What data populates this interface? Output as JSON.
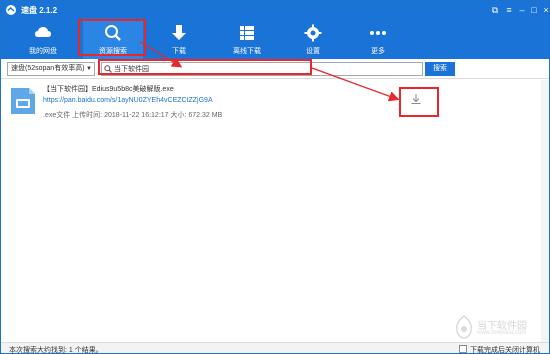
{
  "window": {
    "title": "速盘 2.1.2",
    "controls": [
      "restore-icon",
      "settings-icon",
      "minimize-icon",
      "maximize-icon",
      "close-icon"
    ]
  },
  "toolbar": {
    "items": [
      {
        "label": "我的网盘",
        "icon": "cloud-icon"
      },
      {
        "label": "资源搜索",
        "icon": "search-icon",
        "active": true
      },
      {
        "label": "下载",
        "icon": "download-icon"
      },
      {
        "label": "离线下载",
        "icon": "grid-list-icon"
      },
      {
        "label": "设置",
        "icon": "gear-icon"
      },
      {
        "label": "更多",
        "icon": "more-icon"
      }
    ]
  },
  "search": {
    "source": "速盘(52sopan有效率高)",
    "query": "当下软件园",
    "button": "搜索"
  },
  "results": [
    {
      "name": "【当下软件园】Edius9u5b8c美破解版.exe",
      "url": "https://pan.baidu.com/s/1ayNU0ZYEh4vCEZCtZZjG9A",
      "meta": ".exe文件 上传时间: 2018-11-22 16:12:17 大小: 672.32 MB"
    }
  ],
  "status": {
    "text": "本次搜索大约找到: 1 个结果。",
    "shutdown_label": "下载完成后关闭计算机"
  },
  "watermark": {
    "text": "当下软件园",
    "sub": "www.downxia.com"
  },
  "colors": {
    "accent": "#1a73d6",
    "highlight": "#e8262b"
  }
}
